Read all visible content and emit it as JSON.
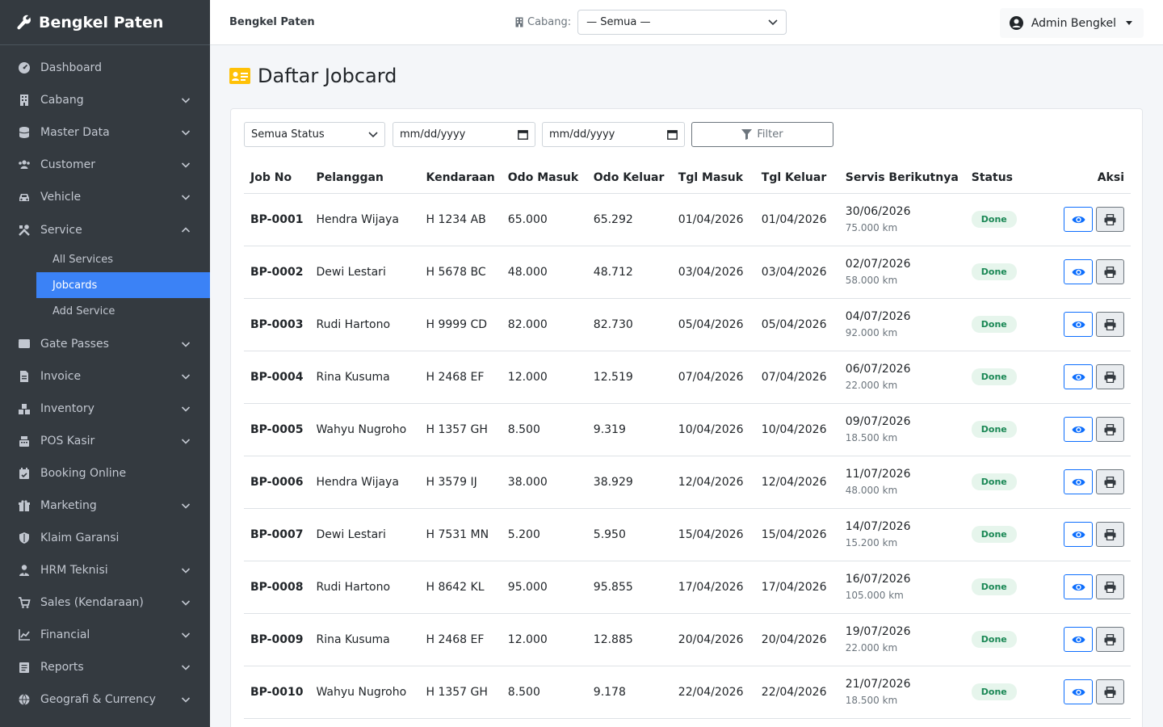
{
  "sidebar": {
    "brand": "Bengkel Paten",
    "items": [
      {
        "label": "Dashboard",
        "icon": "dashboard-icon",
        "has_children": false
      },
      {
        "label": "Cabang",
        "icon": "building-icon",
        "has_children": true
      },
      {
        "label": "Master Data",
        "icon": "database-icon",
        "has_children": true
      },
      {
        "label": "Customer",
        "icon": "users-icon",
        "has_children": true
      },
      {
        "label": "Vehicle",
        "icon": "car-icon",
        "has_children": true
      },
      {
        "label": "Service",
        "icon": "tools-icon",
        "has_children": true,
        "expanded": true
      },
      {
        "label": "Gate Passes",
        "icon": "ticket-icon",
        "has_children": true
      },
      {
        "label": "Invoice",
        "icon": "file-invoice-icon",
        "has_children": true
      },
      {
        "label": "Inventory",
        "icon": "boxes-icon",
        "has_children": true
      },
      {
        "label": "POS Kasir",
        "icon": "cash-register-icon",
        "has_children": true
      },
      {
        "label": "Booking Online",
        "icon": "calendar-check-icon",
        "has_children": false
      },
      {
        "label": "Marketing",
        "icon": "gift-icon",
        "has_children": true
      },
      {
        "label": "Klaim Garansi",
        "icon": "shield-icon",
        "has_children": false
      },
      {
        "label": "HRM Teknisi",
        "icon": "user-tie-icon",
        "has_children": true
      },
      {
        "label": "Sales (Kendaraan)",
        "icon": "cart-icon",
        "has_children": true
      },
      {
        "label": "Financial",
        "icon": "chart-line-icon",
        "has_children": true
      },
      {
        "label": "Reports",
        "icon": "list-icon",
        "has_children": true
      },
      {
        "label": "Geografi & Currency",
        "icon": "globe-icon",
        "has_children": true
      }
    ],
    "service_sub": [
      {
        "label": "All Services",
        "active": false
      },
      {
        "label": "Jobcards",
        "active": true
      },
      {
        "label": "Add Service",
        "active": false
      }
    ]
  },
  "topbar": {
    "brand": "Bengkel Paten",
    "branch_label": "Cabang:",
    "branch_value": "— Semua —",
    "user": "Admin Bengkel"
  },
  "page": {
    "title": "Daftar Jobcard"
  },
  "filters": {
    "status": "Semua Status",
    "date_from": "mm/dd/yyyy",
    "date_to": "mm/dd/yyyy",
    "button": "Filter"
  },
  "table": {
    "headers": [
      "Job No",
      "Pelanggan",
      "Kendaraan",
      "Odo Masuk",
      "Odo Keluar",
      "Tgl Masuk",
      "Tgl Keluar",
      "Servis Berikutnya",
      "Status",
      "Aksi"
    ],
    "rows": [
      {
        "job": "BP-0001",
        "customer": "Hendra Wijaya",
        "vehicle": "H 1234 AB",
        "odo_in": "65.000",
        "odo_out": "65.292",
        "date_in": "01/04/2026",
        "date_out": "01/04/2026",
        "next_date": "30/06/2026",
        "next_km": "75.000 km",
        "status": "Done"
      },
      {
        "job": "BP-0002",
        "customer": "Dewi Lestari",
        "vehicle": "H 5678 BC",
        "odo_in": "48.000",
        "odo_out": "48.712",
        "date_in": "03/04/2026",
        "date_out": "03/04/2026",
        "next_date": "02/07/2026",
        "next_km": "58.000 km",
        "status": "Done"
      },
      {
        "job": "BP-0003",
        "customer": "Rudi Hartono",
        "vehicle": "H 9999 CD",
        "odo_in": "82.000",
        "odo_out": "82.730",
        "date_in": "05/04/2026",
        "date_out": "05/04/2026",
        "next_date": "04/07/2026",
        "next_km": "92.000 km",
        "status": "Done"
      },
      {
        "job": "BP-0004",
        "customer": "Rina Kusuma",
        "vehicle": "H 2468 EF",
        "odo_in": "12.000",
        "odo_out": "12.519",
        "date_in": "07/04/2026",
        "date_out": "07/04/2026",
        "next_date": "06/07/2026",
        "next_km": "22.000 km",
        "status": "Done"
      },
      {
        "job": "BP-0005",
        "customer": "Wahyu Nugroho",
        "vehicle": "H 1357 GH",
        "odo_in": "8.500",
        "odo_out": "9.319",
        "date_in": "10/04/2026",
        "date_out": "10/04/2026",
        "next_date": "09/07/2026",
        "next_km": "18.500 km",
        "status": "Done"
      },
      {
        "job": "BP-0006",
        "customer": "Hendra Wijaya",
        "vehicle": "H 3579 IJ",
        "odo_in": "38.000",
        "odo_out": "38.929",
        "date_in": "12/04/2026",
        "date_out": "12/04/2026",
        "next_date": "11/07/2026",
        "next_km": "48.000 km",
        "status": "Done"
      },
      {
        "job": "BP-0007",
        "customer": "Dewi Lestari",
        "vehicle": "H 7531 MN",
        "odo_in": "5.200",
        "odo_out": "5.950",
        "date_in": "15/04/2026",
        "date_out": "15/04/2026",
        "next_date": "14/07/2026",
        "next_km": "15.200 km",
        "status": "Done"
      },
      {
        "job": "BP-0008",
        "customer": "Rudi Hartono",
        "vehicle": "H 8642 KL",
        "odo_in": "95.000",
        "odo_out": "95.855",
        "date_in": "17/04/2026",
        "date_out": "17/04/2026",
        "next_date": "16/07/2026",
        "next_km": "105.000 km",
        "status": "Done"
      },
      {
        "job": "BP-0009",
        "customer": "Rina Kusuma",
        "vehicle": "H 2468 EF",
        "odo_in": "12.000",
        "odo_out": "12.885",
        "date_in": "20/04/2026",
        "date_out": "20/04/2026",
        "next_date": "19/07/2026",
        "next_km": "22.000 km",
        "status": "Done"
      },
      {
        "job": "BP-0010",
        "customer": "Wahyu Nugroho",
        "vehicle": "H 1357 GH",
        "odo_in": "8.500",
        "odo_out": "9.178",
        "date_in": "22/04/2026",
        "date_out": "22/04/2026",
        "next_date": "21/07/2026",
        "next_km": "18.500 km",
        "status": "Done"
      }
    ]
  },
  "colors": {
    "sidebar_bg": "#343a40",
    "active": "#3b82f6",
    "primary": "#0d6efd",
    "success": "#198754",
    "title_icon": "#ffc107"
  }
}
